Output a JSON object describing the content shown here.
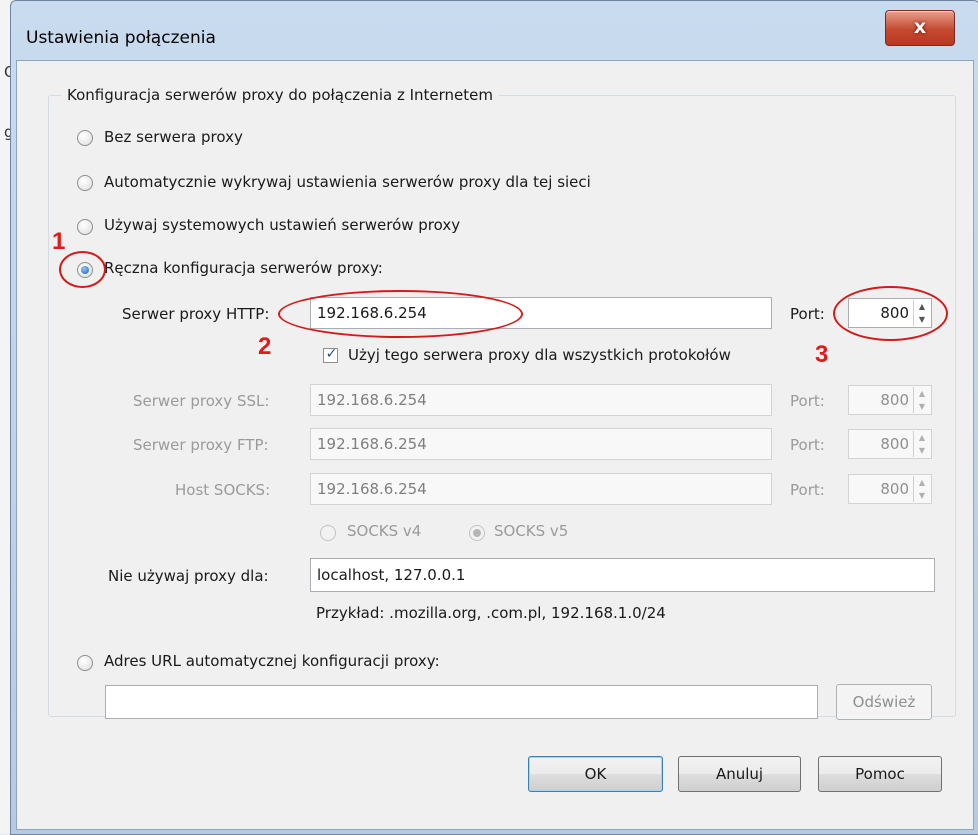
{
  "background_fragments": [
    "O",
    "g"
  ],
  "window": {
    "title": "Ustawienia połączenia",
    "close_icon": "close-icon",
    "close_glyph": "x"
  },
  "group": {
    "title": "Konfiguracja serwerów proxy do połączenia z Internetem"
  },
  "options": {
    "no_proxy": "Bez serwera proxy",
    "auto_detect": "Automatycznie wykrywaj ustawienia serwerów proxy dla tej sieci",
    "system": "Używaj systemowych ustawień serwerów proxy",
    "manual": "Ręczna konfiguracja serwerów proxy:",
    "auto_url": "Adres URL automatycznej konfiguracji proxy:"
  },
  "selected_option": "manual",
  "http": {
    "label": "Serwer proxy HTTP:",
    "value": "192.168.6.254",
    "port_label": "Port:",
    "port": "800"
  },
  "use_for_all": {
    "label": "Użyj tego serwera proxy dla wszystkich protokołów",
    "checked": true
  },
  "ssl": {
    "label": "Serwer proxy SSL:",
    "value": "192.168.6.254",
    "port_label": "Port:",
    "port": "800"
  },
  "ftp": {
    "label": "Serwer proxy FTP:",
    "value": "192.168.6.254",
    "port_label": "Port:",
    "port": "800"
  },
  "socks": {
    "label": "Host SOCKS:",
    "value": "192.168.6.254",
    "port_label": "Port:",
    "port": "800",
    "v4": "SOCKS v4",
    "v5": "SOCKS v5",
    "selected": "v5"
  },
  "no_proxy_for": {
    "label": "Nie używaj proxy dla:",
    "value": "localhost, 127.0.0.1",
    "example": "Przykład: .mozilla.org, .com.pl, 192.168.1.0/24"
  },
  "auto_url": {
    "value": "",
    "reload_label": "Odśwież"
  },
  "buttons": {
    "ok": "OK",
    "cancel": "Anuluj",
    "help": "Pomoc"
  },
  "annotations": {
    "one": "1",
    "two": "2",
    "three": "3",
    "color": "#e01b1b"
  }
}
